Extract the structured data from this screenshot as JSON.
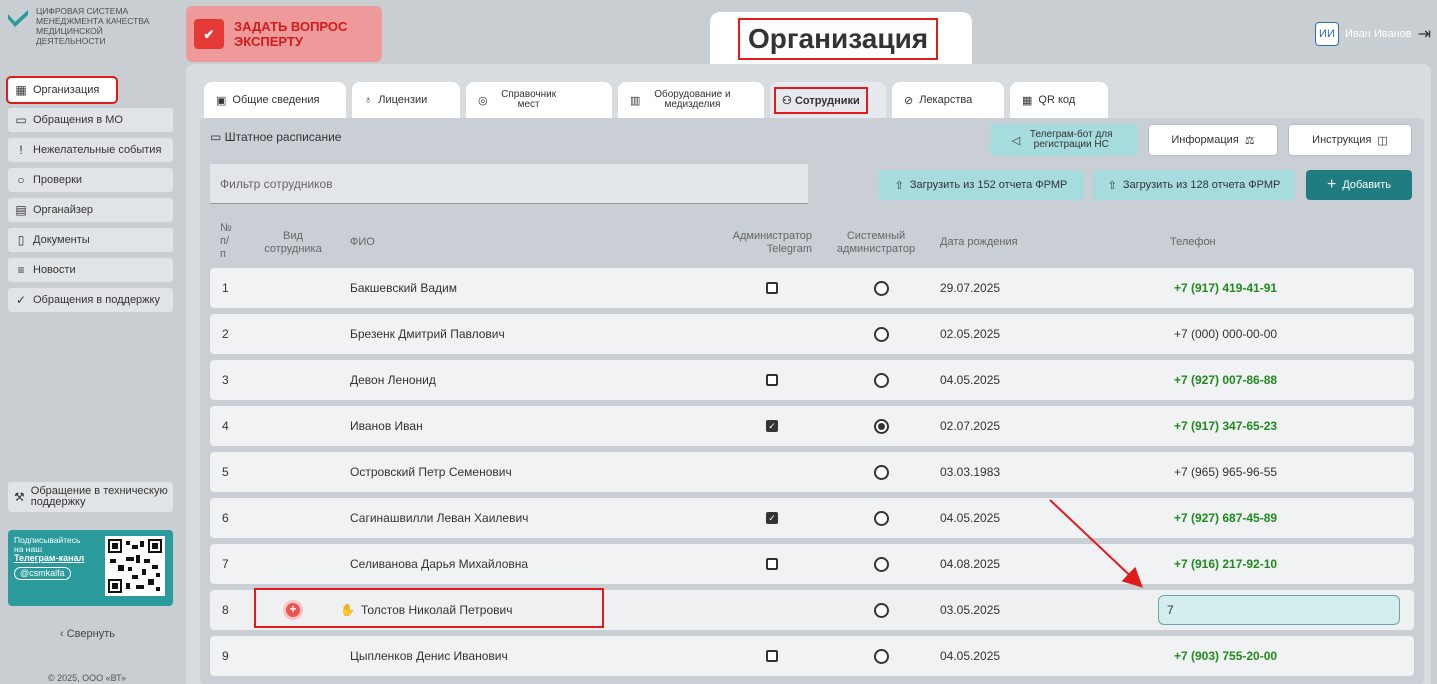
{
  "brand": {
    "logo_text": "ЦИФРОВАЯ СИСТЕМА МЕНЕДЖМЕНТА КАЧЕСТВА МЕДИЦИНСКОЙ ДЕЯТЕЛЬНОСТИ"
  },
  "sidebar": {
    "items": [
      {
        "label": "Организация",
        "icon": "building-icon"
      },
      {
        "label": "Обращения в МО",
        "icon": "chat-icon"
      },
      {
        "label": "Нежелательные события",
        "icon": "alert-icon"
      },
      {
        "label": "Проверки",
        "icon": "search-icon"
      },
      {
        "label": "Органайзер",
        "icon": "calendar-icon"
      },
      {
        "label": "Документы",
        "icon": "documents-icon"
      },
      {
        "label": "Новости",
        "icon": "news-icon"
      },
      {
        "label": "Обращения в поддержку",
        "icon": "support-icon"
      }
    ],
    "tech_support_label": "Обращение в техническую поддержку",
    "telegram_card": {
      "line1": "Подписывайтесь",
      "line2": "на наш",
      "link": "Телеграм-канал",
      "handle": "@csmkalfa"
    },
    "collapse_label": "Свернуть",
    "copyright": "© 2025, ООО «ВТ»"
  },
  "header": {
    "ask_expert_label": "ЗАДАТЬ ВОПРОС ЭКСПЕРТУ",
    "page_title": "Организация",
    "user_initials": "ИИ",
    "user_name": "Иван Иванов"
  },
  "tabs": [
    {
      "label": "Общие сведения",
      "icon": "info-icon"
    },
    {
      "label": "Лицензии",
      "icon": "license-icon"
    },
    {
      "label": "Справочник мест",
      "icon": "location-icon"
    },
    {
      "label": "Оборудование и медизделия",
      "icon": "equipment-icon"
    },
    {
      "label": "Сотрудники",
      "icon": "staff-icon"
    },
    {
      "label": "Лекарства",
      "icon": "pill-icon"
    },
    {
      "label": "QR код",
      "icon": "qr-icon"
    }
  ],
  "staff": {
    "section_label": "Штатное расписание",
    "telegram_bot_label": "Телеграм-бот для регистрации НС",
    "info_label": "Информация",
    "instruction_label": "Инструкция",
    "filter_placeholder": "Фильтр сотрудников",
    "upload152_label": "Загрузить из 152 отчета ФРМР",
    "upload128_label": "Загрузить из 128 отчета ФРМР",
    "add_label": "Добавить",
    "columns": {
      "num": "№ п/п",
      "type": "Вид сотрудника",
      "fio": "ФИО",
      "tg_admin": "Администратор Telegram",
      "sys_admin": "Системный администратор",
      "birth": "Дата рождения",
      "phone": "Телефон"
    },
    "rows": [
      {
        "num": "1",
        "fio": "Бакшевский Вадим",
        "tg": "unchecked",
        "sys": false,
        "birth": "29.07.2025",
        "phone": "+7 (917) 419-41-91",
        "phone_green": true
      },
      {
        "num": "2",
        "fio": "Брезенк Дмитрий Павлович",
        "tg": "none",
        "sys": false,
        "birth": "02.05.2025",
        "phone": "+7 (000) 000-00-00",
        "phone_green": false
      },
      {
        "num": "3",
        "fio": "Девон Ленонид",
        "tg": "unchecked",
        "sys": false,
        "birth": "04.05.2025",
        "phone": "+7 (927) 007-86-88",
        "phone_green": true
      },
      {
        "num": "4",
        "fio": "Иванов Иван",
        "tg": "checked",
        "sys": true,
        "birth": "02.07.2025",
        "phone": "+7 (917) 347-65-23",
        "phone_green": true
      },
      {
        "num": "5",
        "fio": "Островский Петр Семенович",
        "tg": "none",
        "sys": false,
        "birth": "03.03.1983",
        "phone": "+7 (965) 965-96-55",
        "phone_green": false
      },
      {
        "num": "6",
        "fio": "Сагинашвилли Леван Хаилевич",
        "tg": "checked",
        "sys": false,
        "birth": "04.05.2025",
        "phone": "+7 (927) 687-45-89",
        "phone_green": true
      },
      {
        "num": "7",
        "fio": "Селиванова Дарья Михайловна",
        "tg": "unchecked",
        "sys": false,
        "birth": "04.08.2025",
        "phone": "+7 (916) 217-92-10",
        "phone_green": true
      },
      {
        "num": "8",
        "fio": "Толстов Николай Петрович",
        "tg": "none",
        "sys": false,
        "birth": "03.05.2025",
        "phone_input": "7",
        "editing": true
      },
      {
        "num": "9",
        "fio": "Цыпленков Денис Иванович",
        "tg": "unchecked",
        "sys": false,
        "birth": "04.05.2025",
        "phone": "+7 (903) 755-20-00",
        "phone_green": true
      }
    ]
  },
  "colors": {
    "accent_teal": "#1f7d82",
    "light_teal": "#a6dcdd",
    "annotation_red": "#e01b1b",
    "phone_green": "#1f8a1f"
  }
}
